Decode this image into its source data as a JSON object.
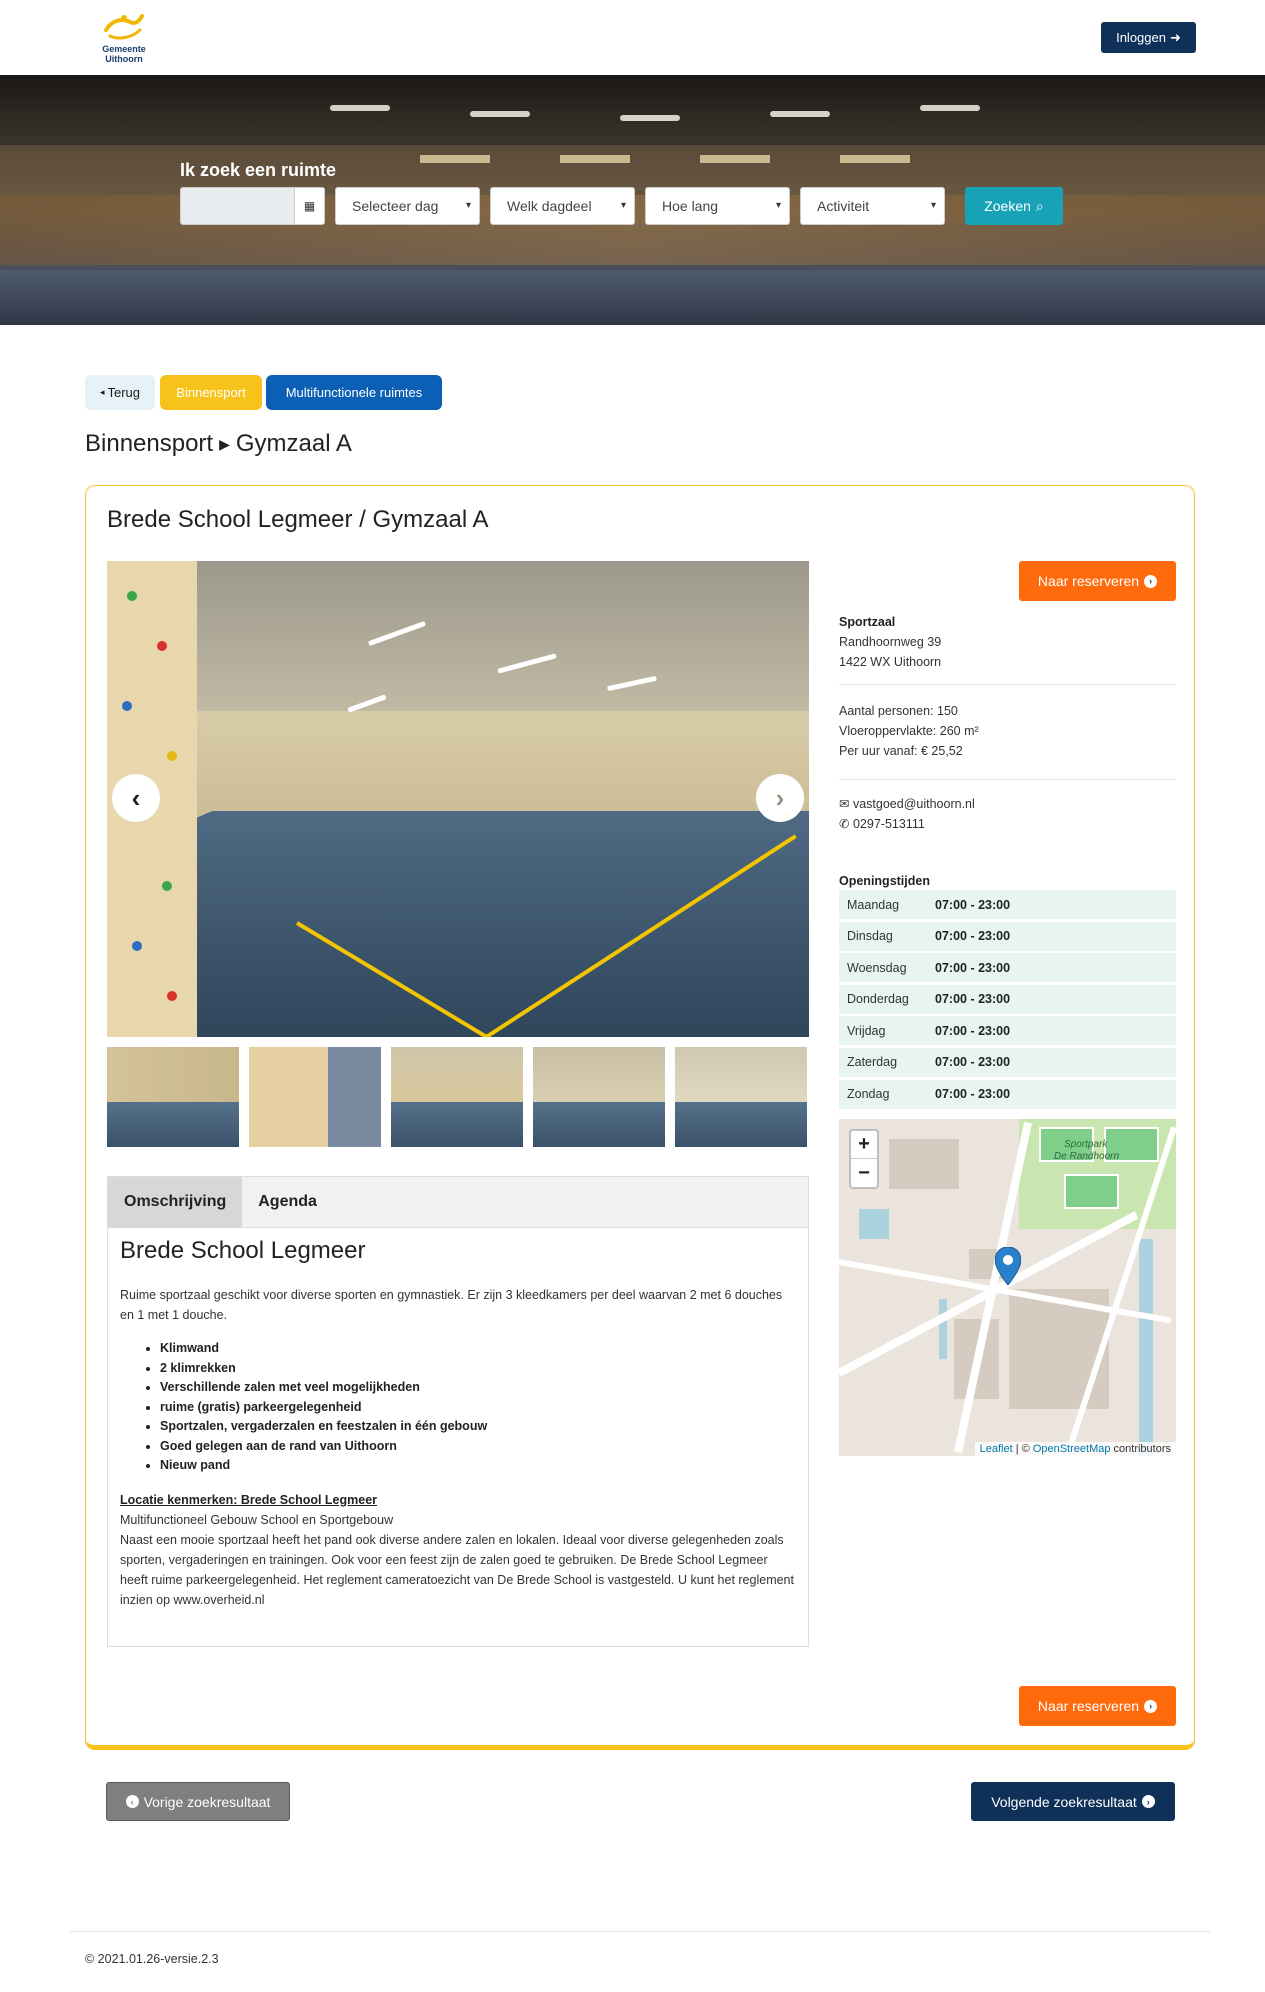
{
  "header": {
    "logo_text": "Gemeente Uithoorn",
    "login_label": "Inloggen",
    "login_icon": "sign-in-icon"
  },
  "search": {
    "title": "Ik zoek een ruimte",
    "date_value": "",
    "day_select": "Selecteer dag",
    "part_select": "Welk dagdeel",
    "duration_select": "Hoe lang",
    "activity_select": "Activiteit",
    "submit_label": "Zoeken"
  },
  "nav": {
    "back_label": "Terug",
    "category1": "Binnensport",
    "category2": "Multifunctionele ruimtes"
  },
  "breadcrumb": {
    "parent": "Binnensport",
    "current": "Gymzaal A"
  },
  "card": {
    "title": "Brede School Legmeer / Gymzaal A",
    "reserve_label": "Naar reserveren"
  },
  "location": {
    "type": "Sportzaal",
    "street": "Randhoornweg 39",
    "postcode_city": "1422 WX Uithoorn",
    "persons": "Aantal personen: 150",
    "floor_area": "Vloeroppervlakte: 260 m²",
    "price": "Per uur vanaf: € 25,52",
    "email": "vastgoed@uithoorn.nl",
    "phone": "0297-513111"
  },
  "hours": {
    "title": "Openingstijden",
    "rows": [
      {
        "day": "Maandag",
        "time": "07:00 - 23:00"
      },
      {
        "day": "Dinsdag",
        "time": "07:00 - 23:00"
      },
      {
        "day": "Woensdag",
        "time": "07:00 - 23:00"
      },
      {
        "day": "Donderdag",
        "time": "07:00 - 23:00"
      },
      {
        "day": "Vrijdag",
        "time": "07:00 - 23:00"
      },
      {
        "day": "Zaterdag",
        "time": "07:00 - 23:00"
      },
      {
        "day": "Zondag",
        "time": "07:00 - 23:00"
      }
    ]
  },
  "map": {
    "zoom_in": "+",
    "zoom_out": "−",
    "label_park1": "Sportpark",
    "label_park2": "De Randhoorn",
    "attribution_leaflet": "Leaflet",
    "attribution_sep": " | © ",
    "attribution_osm": "OpenStreetMap",
    "attribution_tail": " contributors"
  },
  "tabs": {
    "tab1": "Omschrijving",
    "tab2": "Agenda"
  },
  "description": {
    "title": "Brede School Legmeer",
    "intro": "Ruime sportzaal geschikt voor diverse sporten en gymnastiek. Er zijn 3 kleedkamers per deel waarvan 2 met 6 douches en 1 met 1 douche.",
    "features": [
      "Klimwand",
      "2 klimrekken",
      "Verschillende zalen met veel mogelijkheden",
      "ruime (gratis) parkeergelegenheid",
      "Sportzalen, vergaderzalen en feestzalen in één gebouw",
      "Goed gelegen aan de rand van Uithoorn",
      "Nieuw pand"
    ],
    "location_heading": "Locatie kenmerken: Brede School Legmeer",
    "location_sub": "Multifunctioneel Gebouw School en Sportgebouw",
    "location_text": "Naast een mooie sportzaal heeft het pand ook diverse andere zalen en lokalen. Ideaal voor diverse gelegenheden zoals sporten, vergaderingen en trainingen. Ook voor een feest zijn de zalen goed te gebruiken. De Brede School Legmeer heeft ruime parkeergelegenheid. Het reglement cameratoezicht van De Brede School is vastgesteld. U kunt het reglement inzien op www.overheid.nl"
  },
  "pager": {
    "prev_label": "Vorige zoekresultaat",
    "next_label": "Volgende zoekresultaat"
  },
  "footer": {
    "version": "© 2021.01.26-versie.2.3"
  },
  "colors": {
    "navy": "#0f3058",
    "teal": "#17a2b8",
    "orange": "#ff6a0d",
    "yellow": "#f7c31a",
    "blue": "#0b5fb5",
    "hours_bg": "#e7f5ee"
  }
}
